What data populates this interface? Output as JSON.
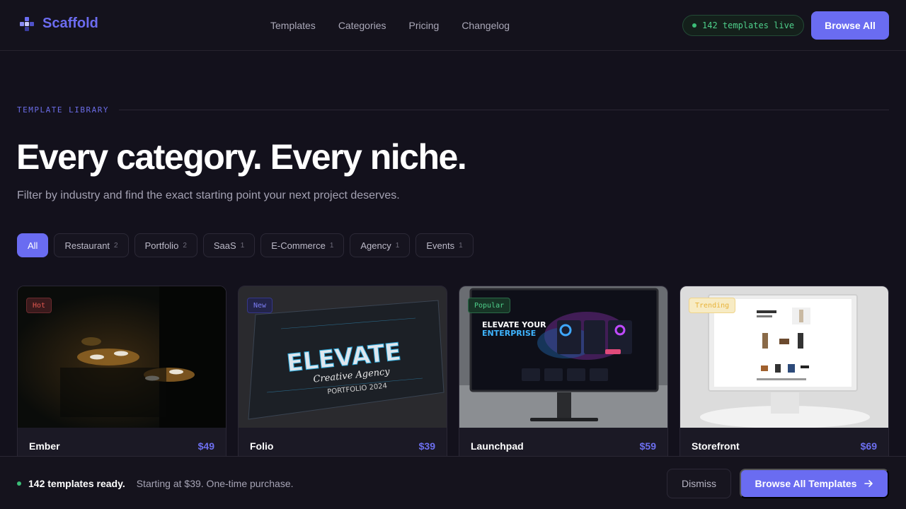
{
  "brand": {
    "name": "Scaffold"
  },
  "nav": {
    "items": [
      "Templates",
      "Categories",
      "Pricing",
      "Changelog"
    ]
  },
  "header": {
    "live_status": "142 templates live",
    "browse_all": "Browse All"
  },
  "hero": {
    "eyebrow": "TEMPLATE LIBRARY",
    "title": "Every category. Every niche.",
    "subtitle": "Filter by industry and find the exact starting point your next project deserves."
  },
  "filters": [
    {
      "label": "All",
      "count": "",
      "active": true
    },
    {
      "label": "Restaurant",
      "count": "2"
    },
    {
      "label": "Portfolio",
      "count": "2"
    },
    {
      "label": "SaaS",
      "count": "1"
    },
    {
      "label": "E-Commerce",
      "count": "1"
    },
    {
      "label": "Agency",
      "count": "1"
    },
    {
      "label": "Events",
      "count": "1"
    }
  ],
  "cards": [
    {
      "title": "Ember",
      "price": "$49",
      "badge": "Hot",
      "badge_color": "#e0574f"
    },
    {
      "title": "Folio",
      "price": "$39",
      "badge": "New",
      "badge_color": "#7b7df3",
      "thumb_text": {
        "main": "ELEVATE",
        "script": "Creative Agency",
        "sub": "PORTFOLIO 2024"
      }
    },
    {
      "title": "Launchpad",
      "price": "$59",
      "badge": "Popular",
      "badge_color": "#3fc07f",
      "thumb_text": {
        "line1": "ELEVATE YOUR",
        "line2": "ENTERPRISE"
      }
    },
    {
      "title": "Storefront",
      "price": "$69",
      "badge": "Trending",
      "badge_color": "#e8b33a"
    }
  ],
  "bottom_bar": {
    "strong": "142 templates ready.",
    "muted": "Starting at $39. One-time purchase.",
    "dismiss": "Dismiss",
    "cta": "Browse All Templates",
    "cta_icon": "arrow-right-icon"
  },
  "colors": {
    "accent": "#6a6cf1",
    "live": "#3bbd77",
    "bg": "#13111c"
  }
}
